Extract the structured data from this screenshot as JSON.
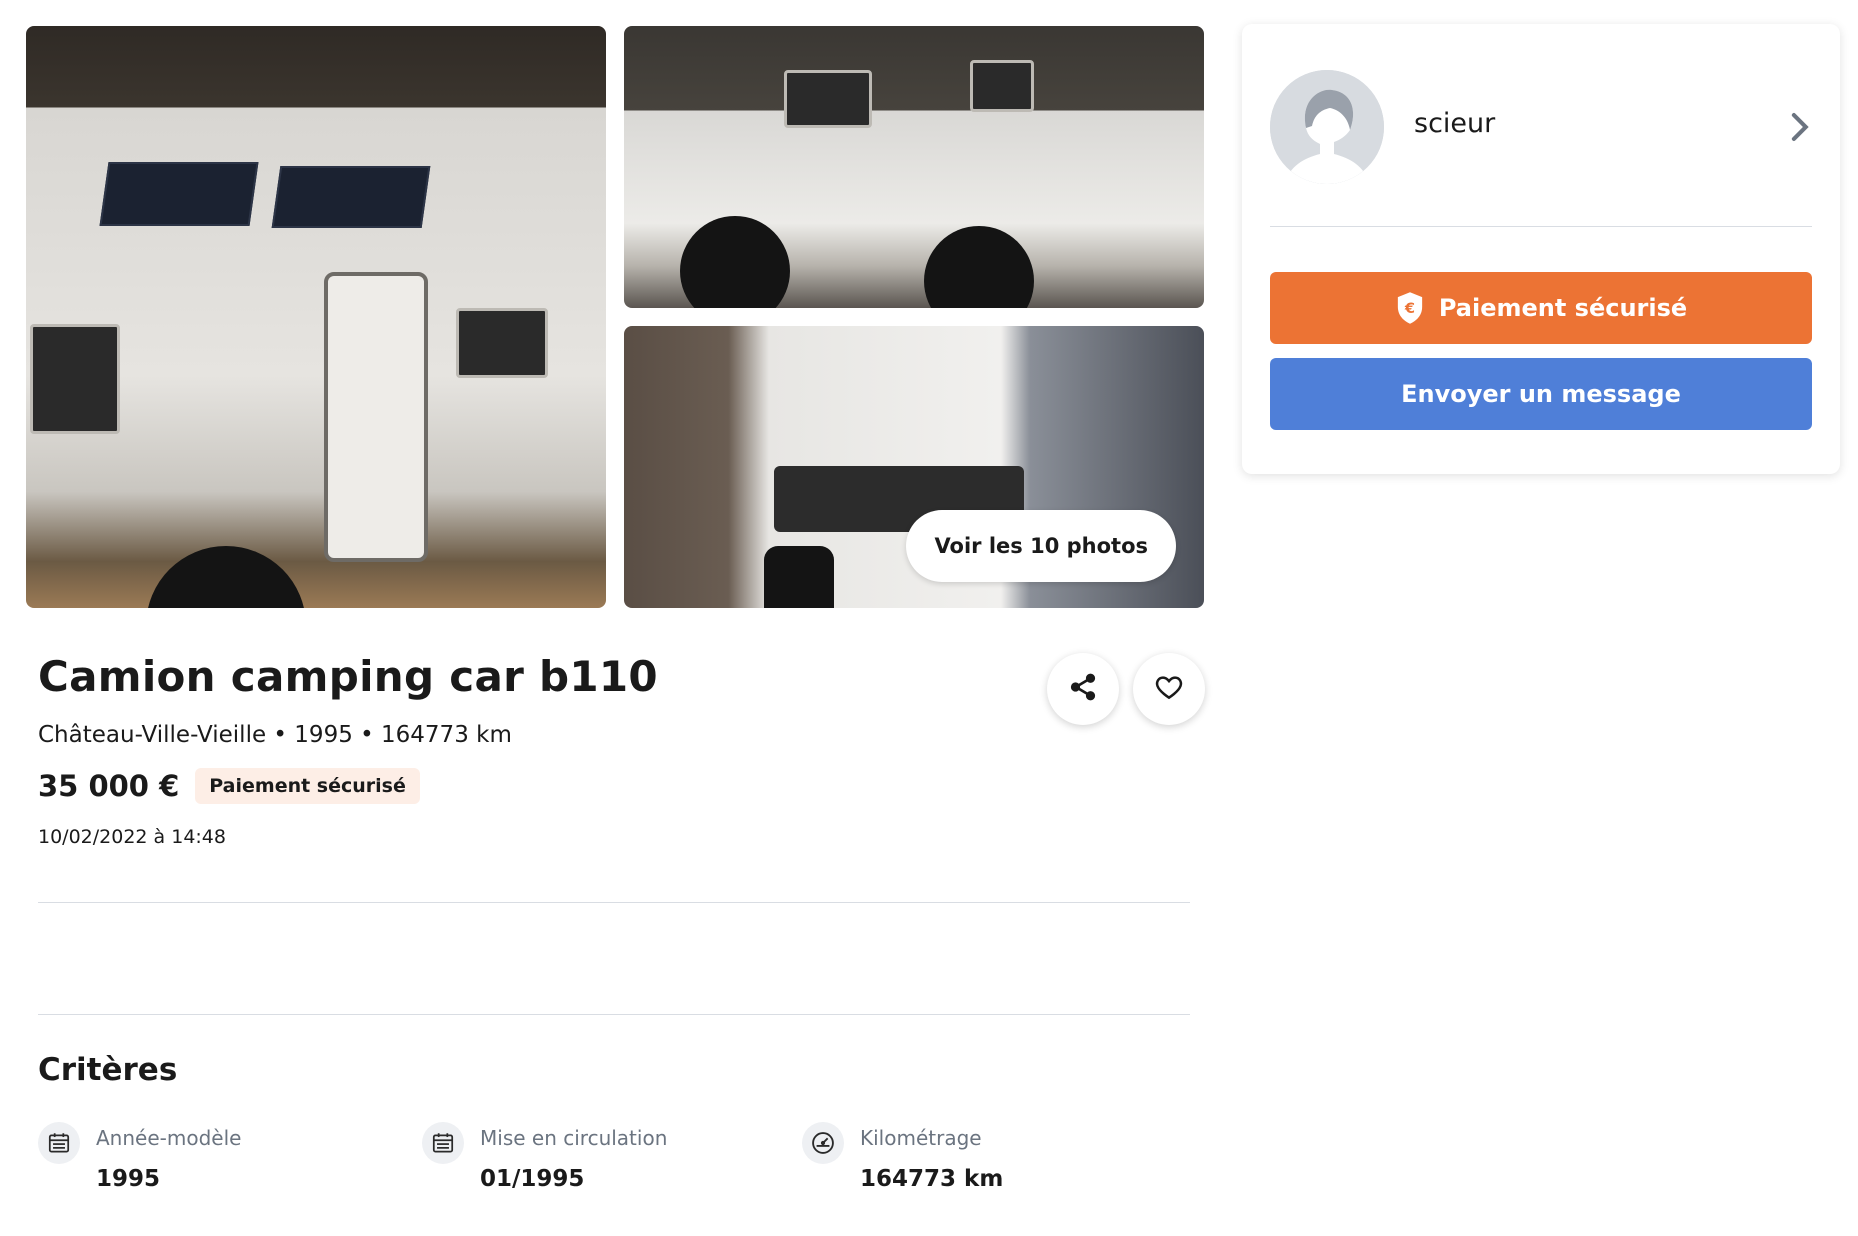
{
  "gallery": {
    "view_photos_label": "Voir les 10 photos"
  },
  "listing": {
    "title": "Camion camping car b110",
    "subline": "Château-Ville-Vieille • 1995 • 164773 km",
    "price": "35 000 €",
    "secure_badge": "Paiement sécurisé",
    "date": "10/02/2022 à 14:48"
  },
  "criteria": {
    "heading": "Critères",
    "items": [
      {
        "label": "Année-modèle",
        "value": "1995",
        "icon": "calendar-icon"
      },
      {
        "label": "Mise en circulation",
        "value": "01/1995",
        "icon": "calendar-icon"
      },
      {
        "label": "Kilométrage",
        "value": "164773 km",
        "icon": "speedometer-icon"
      }
    ]
  },
  "seller": {
    "name": "scieur",
    "pay_button": "Paiement sécurisé",
    "message_button": "Envoyer un message"
  },
  "colors": {
    "accent_orange": "#ec7334",
    "accent_blue": "#4f7fd8",
    "badge_bg": "#fdeee6"
  }
}
